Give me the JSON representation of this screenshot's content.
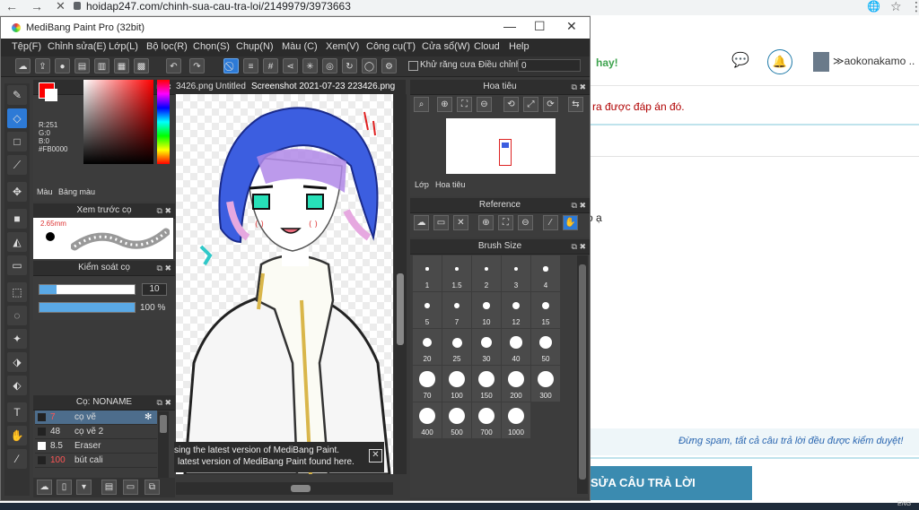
{
  "browser": {
    "url": "hoidap247.com/chinh-sua-cau-tra-loi/2149979/3973663",
    "back_icon": "←",
    "forward_icon": "→",
    "close_icon": "✕",
    "translate_icon": "🌐",
    "star_icon": "☆",
    "more_icon": "⋮"
  },
  "website": {
    "hay_text": "hay!",
    "chat_icon": "💬",
    "bell_icon": "🔔",
    "username": "≫aokonakamo ..",
    "note": "ra được đáp án đó.",
    "fragment": "o ạ",
    "spam_text": "Đừng spam, tất cả câu trả lời đều được kiểm duyệt!",
    "submit_label": "SỬA CÂU TRẢ LỜI",
    "tray_text": "ENG"
  },
  "app": {
    "title": "MediBang Paint Pro (32bit)",
    "min": "—",
    "max": "☐",
    "close": "✕",
    "menu": [
      "Tệp(F)",
      "Chỉnh sửa(E)",
      "Lớp(L)",
      "Bộ lọc(R)",
      "Chọn(S)",
      "Chụp(N)",
      "Màu (C)",
      "Xem(V)",
      "Công cụ(T)",
      "Cửa sổ(W)",
      "Cloud",
      "Help"
    ],
    "antialias_label": "Khử răng cưa",
    "adjust_label": "Điều chỉnh",
    "adjust_value": "0"
  },
  "color_panel": {
    "title": "Màu",
    "r": "R:251",
    "g": "G:0",
    "b": "B:0",
    "hex": "#FB0000",
    "tab1": "Màu",
    "tab2": "Bảng màu",
    "fg_color": "#FB0000"
  },
  "brush_preview": {
    "title": "Xem trước cọ",
    "size": "2.65mm"
  },
  "brush_control": {
    "title": "Kiểm soát cọ",
    "size_value": "10",
    "opacity_value": "100 %",
    "opacity_fraction": 1.0
  },
  "brush_list": {
    "title": "Cọ: NONAME",
    "items": [
      {
        "num": "7",
        "name": "cọ vẽ",
        "swatch": "#222222"
      },
      {
        "num": "48",
        "name": "cọ vẽ 2",
        "swatch": "#222222"
      },
      {
        "num": "8.5",
        "name": "Eraser",
        "swatch": "#ffffff"
      },
      {
        "num": "100",
        "name": "bút cali",
        "swatch": "#222222"
      }
    ]
  },
  "documents": {
    "tabs": [
      "3426.png",
      "Untitled",
      "Screenshot 2021-07-23 223426.png"
    ]
  },
  "notice": {
    "line1": "sing the latest version of MediBang Paint.",
    "line2": "latest version of MediBang Paint found here."
  },
  "navigator": {
    "title": "Hoa tiêu",
    "tab1": "Lớp",
    "tab2": "Hoa tiêu"
  },
  "reference": {
    "title": "Reference"
  },
  "brush_size": {
    "title": "Brush Size",
    "sizes": [
      "1",
      "1.5",
      "2",
      "3",
      "4",
      "5",
      "7",
      "10",
      "12",
      "15",
      "20",
      "25",
      "30",
      "40",
      "50",
      "70",
      "100",
      "150",
      "200",
      "300",
      "400",
      "500",
      "700",
      "1000"
    ]
  }
}
